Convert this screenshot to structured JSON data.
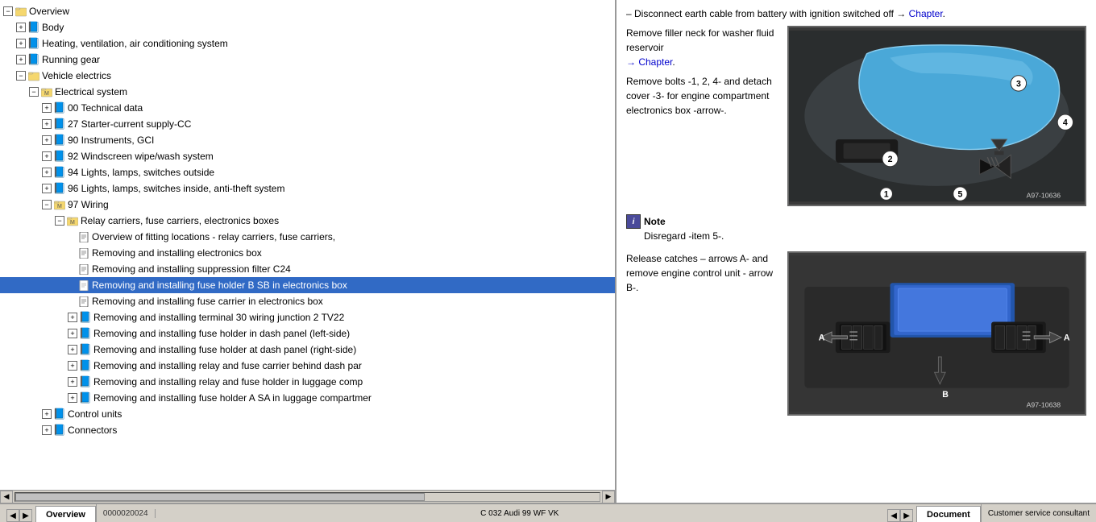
{
  "tree": {
    "items": [
      {
        "id": "overview",
        "label": "Overview",
        "indent": 0,
        "type": "folder-open",
        "expanded": true
      },
      {
        "id": "body",
        "label": "Body",
        "indent": 1,
        "type": "book"
      },
      {
        "id": "hvac",
        "label": "Heating, ventilation, air conditioning system",
        "indent": 1,
        "type": "book"
      },
      {
        "id": "running-gear",
        "label": "Running gear",
        "indent": 1,
        "type": "book"
      },
      {
        "id": "vehicle-electrics",
        "label": "Vehicle electrics",
        "indent": 1,
        "type": "folder-open",
        "expanded": true
      },
      {
        "id": "electrical-system",
        "label": "Electrical system",
        "indent": 2,
        "type": "folder-open",
        "expanded": true
      },
      {
        "id": "tech-data",
        "label": "00 Technical data",
        "indent": 3,
        "type": "book-expand"
      },
      {
        "id": "starter",
        "label": "27 Starter-current supply-CC",
        "indent": 3,
        "type": "book-expand"
      },
      {
        "id": "instruments",
        "label": "90 Instruments, GCI",
        "indent": 3,
        "type": "book-expand"
      },
      {
        "id": "windscreen",
        "label": "92 Windscreen wipe/wash system",
        "indent": 3,
        "type": "book-expand"
      },
      {
        "id": "lights94",
        "label": "94 Lights, lamps, switches outside",
        "indent": 3,
        "type": "book-expand"
      },
      {
        "id": "lights96",
        "label": "96 Lights, lamps, switches inside, anti-theft system",
        "indent": 3,
        "type": "book-expand"
      },
      {
        "id": "wiring97",
        "label": "97 Wiring",
        "indent": 3,
        "type": "folder-open",
        "expanded": true
      },
      {
        "id": "relay-carriers",
        "label": "Relay carriers, fuse carriers, electronics boxes",
        "indent": 4,
        "type": "folder-open",
        "expanded": true
      },
      {
        "id": "overview-fitting",
        "label": "Overview of fitting locations - relay carriers, fuse carriers,",
        "indent": 5,
        "type": "page"
      },
      {
        "id": "removing-elec-box",
        "label": "Removing and installing electronics box",
        "indent": 5,
        "type": "page"
      },
      {
        "id": "removing-suppression",
        "label": "Removing and installing suppression filter C24",
        "indent": 5,
        "type": "page"
      },
      {
        "id": "removing-fuse-sb",
        "label": "Removing and installing fuse holder B SB in electronics box",
        "indent": 5,
        "type": "page",
        "selected": true
      },
      {
        "id": "removing-fuse-carrier",
        "label": "Removing and installing fuse carrier in electronics box",
        "indent": 5,
        "type": "page"
      },
      {
        "id": "removing-terminal30",
        "label": "Removing and installing terminal 30 wiring junction 2 TV22",
        "indent": 5,
        "type": "book-expand"
      },
      {
        "id": "removing-fuse-left",
        "label": "Removing and installing fuse holder in dash panel (left-side)",
        "indent": 5,
        "type": "book-expand"
      },
      {
        "id": "removing-fuse-right",
        "label": "Removing and installing fuse holder at dash panel (right-side)",
        "indent": 5,
        "type": "book-expand"
      },
      {
        "id": "removing-relay-dash",
        "label": "Removing and installing relay and fuse carrier behind dash par",
        "indent": 5,
        "type": "book-expand"
      },
      {
        "id": "removing-relay-luggage",
        "label": "Removing and installing relay and fuse holder in luggage comp",
        "indent": 5,
        "type": "book-expand"
      },
      {
        "id": "removing-fuse-sa",
        "label": "Removing and installing fuse holder A SA in luggage compartmer",
        "indent": 5,
        "type": "book-expand"
      },
      {
        "id": "control-units",
        "label": "Control units",
        "indent": 3,
        "type": "book-expand"
      },
      {
        "id": "connectors",
        "label": "Connectors",
        "indent": 3,
        "type": "book-expand"
      }
    ]
  },
  "content": {
    "intro_text": "– Disconnect earth cable from battery with ignition switched off →",
    "chapter_link": "Chapter",
    "section1": {
      "text1": "Remove filler neck for washer fluid reservoir",
      "link1": "→ Chapter",
      "text2": "Remove bolts -1, 2, 4- and detach cover -3- for engine compartment electronics box -arrow-.",
      "image1_id": "A97-10636",
      "labels1": [
        "1",
        "2",
        "3",
        "4",
        "5"
      ]
    },
    "note": {
      "label": "Note",
      "text": "Disregard -item 5-."
    },
    "section2": {
      "text1": "Release catches – arrows A- and remove engine control unit - arrow B-.",
      "image2_id": "A97-10638",
      "labels2": [
        "A",
        "A",
        "B"
      ]
    }
  },
  "tabs": {
    "left": "Overview",
    "right": "Document"
  },
  "status": {
    "left_info": "0000020024",
    "middle_info": "C 032    Audi 99    WF   VK",
    "consultant": "Customer service consultant"
  }
}
